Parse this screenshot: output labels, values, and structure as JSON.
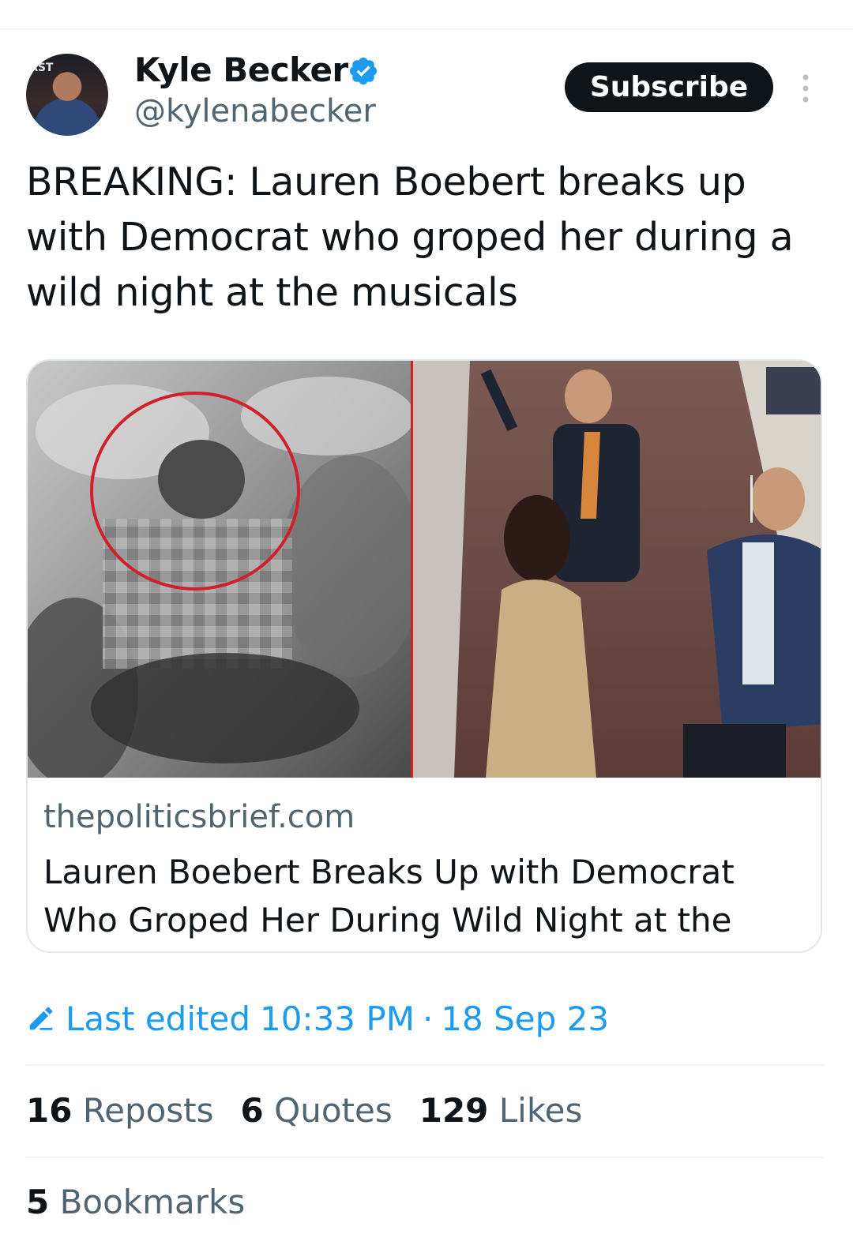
{
  "author": {
    "name": "Kyle Becker",
    "handle": "@kylenabecker",
    "verified": true,
    "avatar_icon": "profile-photo",
    "avatar_background_text": "AST"
  },
  "subscribe_label": "Subscribe",
  "tweet": {
    "text": "BREAKING: Lauren Boebert breaks up with Democrat who groped her during a wild night at the musicals"
  },
  "link_card": {
    "domain": "thepoliticsbrief.com",
    "title": "Lauren Boebert Breaks Up with Democrat Who Groped Her During Wild Night at the Mu..."
  },
  "edit_info": {
    "label": "Last edited",
    "time": "10:33 PM",
    "separator": "·",
    "date": "18 Sep 23",
    "icon": "pencil-icon"
  },
  "stats": [
    {
      "count": "16",
      "label": "Reposts"
    },
    {
      "count": "6",
      "label": "Quotes"
    },
    {
      "count": "129",
      "label": "Likes"
    }
  ],
  "bookmarks": {
    "count": "5",
    "label": "Bookmarks"
  },
  "colors": {
    "accent": "#1d9bf0",
    "text_primary": "#0f1419",
    "text_secondary": "#536471",
    "button_bg": "#0f1419"
  }
}
